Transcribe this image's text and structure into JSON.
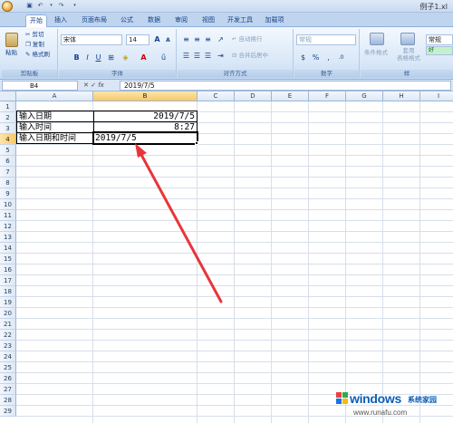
{
  "window": {
    "title": "例子1.xl"
  },
  "tabs": [
    "开始",
    "插入",
    "页面布局",
    "公式",
    "数据",
    "审阅",
    "视图",
    "开发工具",
    "加载项"
  ],
  "ribbon": {
    "clipboard": {
      "paste": "粘贴",
      "cut": "剪切",
      "copy": "复制",
      "format_painter": "格式刷",
      "label": "剪贴板"
    },
    "font": {
      "name": "宋体",
      "size": "14",
      "bold": "B",
      "italic": "I",
      "underline": "U",
      "label": "字体",
      "grow": "A",
      "shrink": "A"
    },
    "alignment": {
      "wrap": "自动换行",
      "merge": "合并后居中",
      "label": "对齐方式"
    },
    "number": {
      "format": "常规",
      "label": "数字"
    },
    "styles": {
      "conditional": "条件格式",
      "table": "套用\n表格格式",
      "normal": "常规",
      "good": "好",
      "label": "样"
    }
  },
  "formula_bar": {
    "name_box": "B4",
    "fx": "fx",
    "value": "2019/7/5"
  },
  "columns": [
    "A",
    "B",
    "C",
    "D",
    "E",
    "F",
    "G",
    "H",
    "I"
  ],
  "rows": [
    "1",
    "2",
    "3",
    "4",
    "5",
    "6",
    "7",
    "8",
    "9",
    "10",
    "11",
    "12",
    "13",
    "14",
    "15",
    "16",
    "17",
    "18",
    "19",
    "20",
    "21",
    "22",
    "23",
    "24",
    "25",
    "26",
    "27",
    "28",
    "29"
  ],
  "cells": {
    "A2": "输入日期",
    "B2": "2019/7/5",
    "A3": "输入时间",
    "B3": "8:27",
    "A4": "输入日期和时间",
    "B4": "2019/7/5"
  },
  "selected_cell": "B4",
  "watermark": {
    "brand": "windows",
    "cn": "系统家园",
    "url": "www.runafu.com"
  },
  "colors": {
    "arrow": "#e8353a",
    "selection": "#f8c86a"
  }
}
